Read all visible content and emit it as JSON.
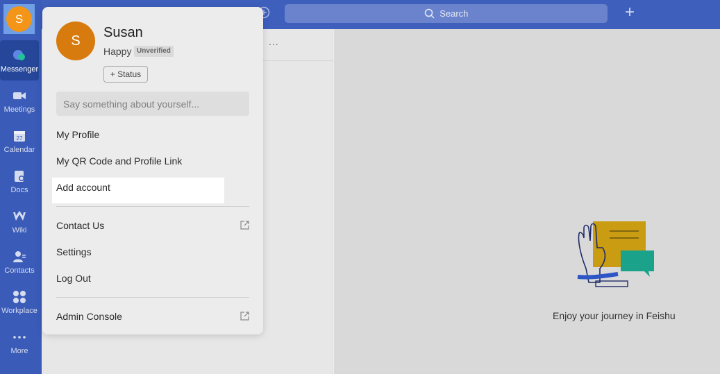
{
  "rail": {
    "avatar_letter": "S",
    "items": [
      {
        "label": "Messenger",
        "icon": "messenger-icon"
      },
      {
        "label": "Meetings",
        "icon": "camera-icon"
      },
      {
        "label": "Calendar",
        "icon": "calendar-icon"
      },
      {
        "label": "Docs",
        "icon": "docs-icon"
      },
      {
        "label": "Wiki",
        "icon": "wiki-icon"
      },
      {
        "label": "Contacts",
        "icon": "contacts-icon"
      },
      {
        "label": "Workplace",
        "icon": "workplace-icon"
      },
      {
        "label": "More",
        "icon": "more-icon"
      }
    ],
    "calendar_day": "27"
  },
  "topbar": {
    "search_label": "Search",
    "plus": "+"
  },
  "list": {
    "more": "..."
  },
  "main": {
    "empty_text": "Enjoy your journey in Feishu"
  },
  "popup": {
    "avatar_letter": "S",
    "name": "Susan",
    "status_text": "Happy",
    "badge": "Unverified",
    "status_button": "+ Status",
    "about_placeholder": "Say something about yourself...",
    "menu": {
      "my_profile": "My Profile",
      "qr_code": "My QR Code and Profile Link",
      "add_account": "Add account",
      "contact_us": "Contact Us",
      "settings": "Settings",
      "log_out": "Log Out",
      "admin_console": "Admin Console"
    }
  },
  "colors": {
    "rail": "#3a5bb8",
    "topbar": "#3f5fbd",
    "avatar": "#f29518",
    "accent_green": "#1aa38a",
    "accent_yellow": "#d49a00"
  }
}
